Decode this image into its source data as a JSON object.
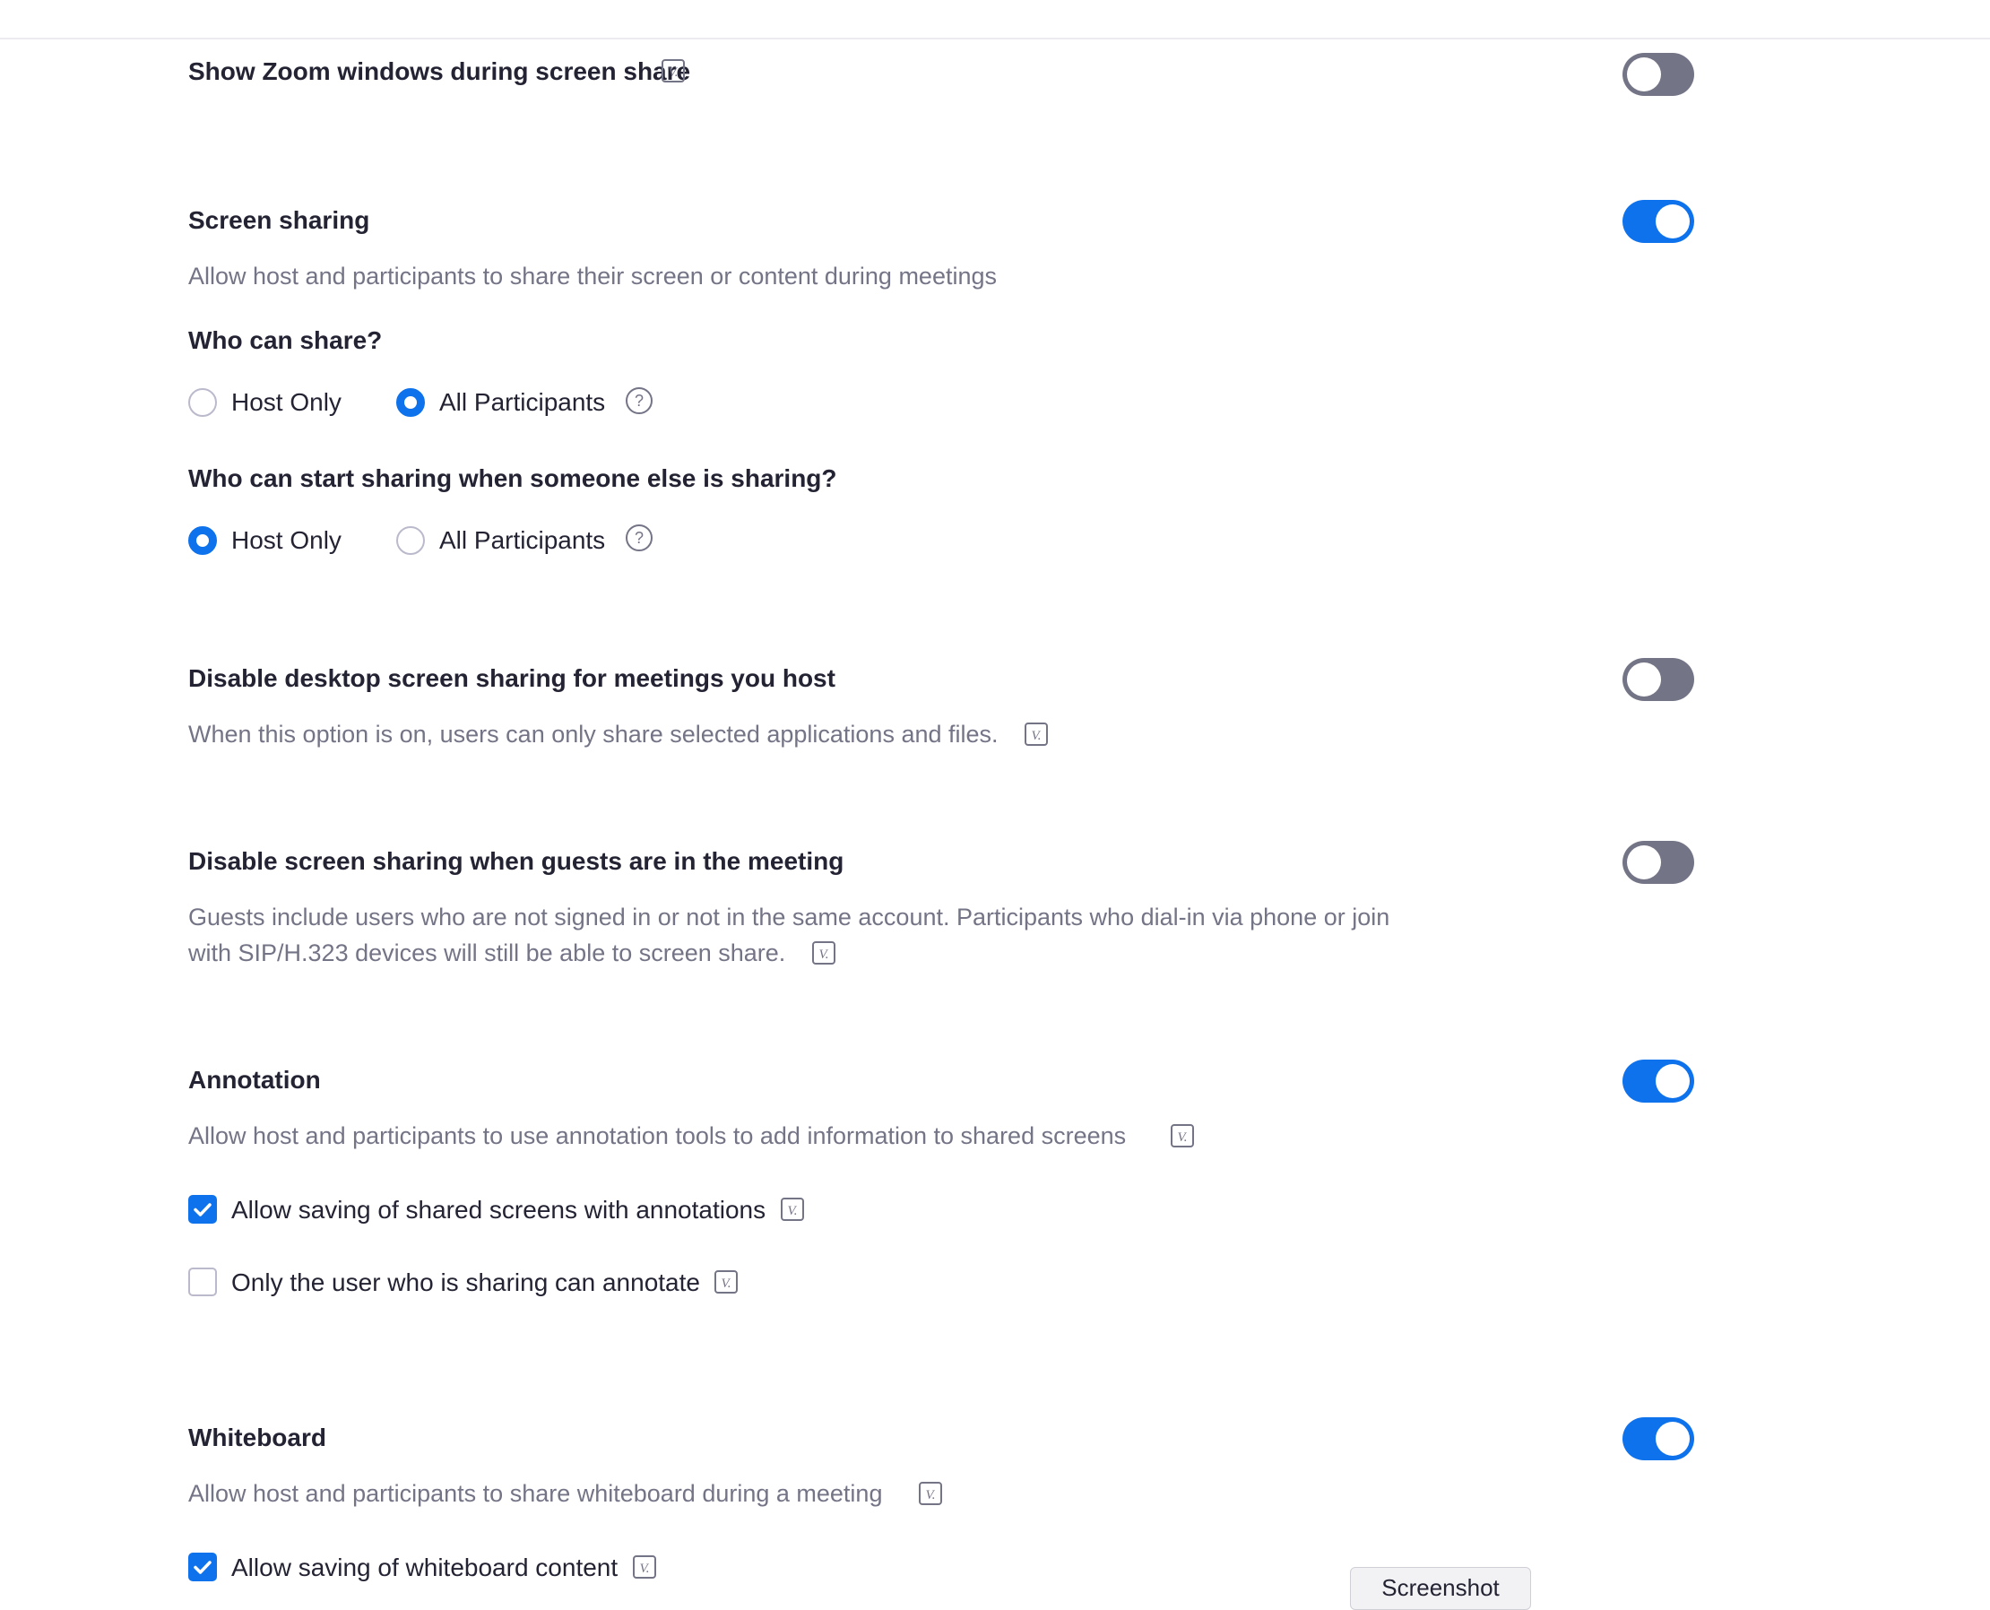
{
  "settings": {
    "show_zoom_windows": {
      "title": "Show Zoom windows during screen share",
      "enabled": false
    },
    "screen_sharing": {
      "title": "Screen sharing",
      "description": "Allow host and participants to share their screen or content during meetings",
      "enabled": true,
      "who_can_share": {
        "question": "Who can share?",
        "options": [
          "Host Only",
          "All Participants"
        ],
        "selected": "All Participants"
      },
      "who_can_start": {
        "question": "Who can start sharing when someone else is sharing?",
        "options": [
          "Host Only",
          "All Participants"
        ],
        "selected": "Host Only"
      }
    },
    "disable_desktop_sharing": {
      "title": "Disable desktop screen sharing for meetings you host",
      "description": "When this option is on, users can only share selected applications and files.",
      "enabled": false
    },
    "disable_sharing_guests": {
      "title": "Disable screen sharing when guests are in the meeting",
      "description_line1": "Guests include users who are not signed in or not in the same account. Participants who dial-in via phone or join",
      "description_line2": "with SIP/H.323 devices will still be able to screen share.",
      "enabled": false
    },
    "annotation": {
      "title": "Annotation",
      "description": "Allow host and participants to use annotation tools to add information to shared screens",
      "enabled": true,
      "options": [
        {
          "label": "Allow saving of shared screens with annotations",
          "checked": true
        },
        {
          "label": "Only the user who is sharing can annotate",
          "checked": false
        }
      ]
    },
    "whiteboard": {
      "title": "Whiteboard",
      "description": "Allow host and participants to share whiteboard during a meeting",
      "enabled": true,
      "options": [
        {
          "label": "Allow saving of whiteboard content",
          "checked": true
        }
      ]
    }
  },
  "overlay": {
    "label": "Screenshot"
  },
  "icons": [
    "version-icon",
    "help-icon",
    "checkmark-icon"
  ],
  "colors": {
    "accent": "#0e72ed",
    "toggle_off": "#747487",
    "title": "#232333",
    "description": "#747487"
  }
}
